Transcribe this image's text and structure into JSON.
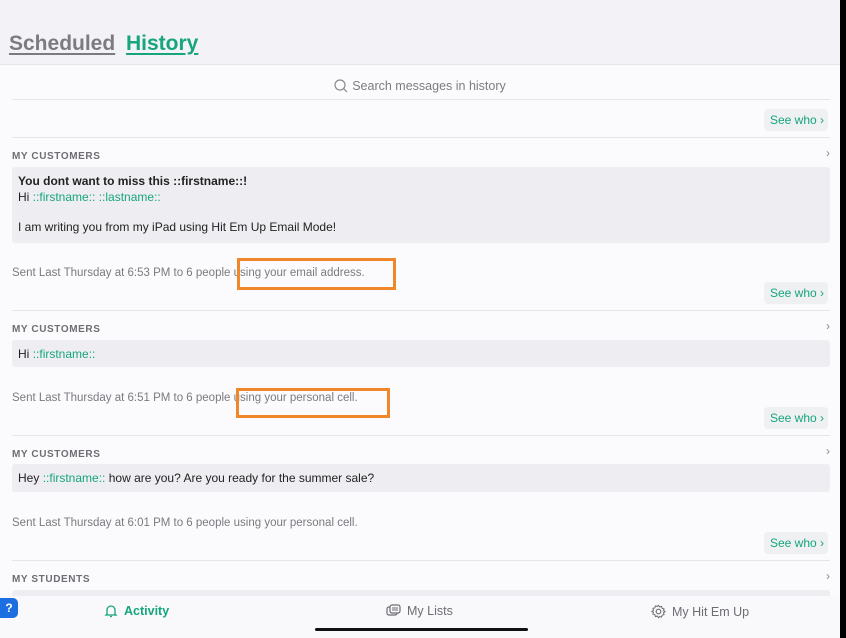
{
  "tabs": {
    "scheduled": "Scheduled",
    "history": "History"
  },
  "search": {
    "placeholder": "Search messages in history"
  },
  "see_who": "See who ›",
  "messages": [
    {
      "group": "MY CUSTOMERS",
      "subject": "You dont want to miss this ::firstname::!",
      "greeting": "Hi",
      "vars": "::firstname:: ::lastname::",
      "body": "I am writing you from my iPad using Hit Em Up Email Mode!",
      "sent": "Sent Last Thursday at 6:53 PM to 6 people",
      "via": " using your email address."
    },
    {
      "group": "MY CUSTOMERS",
      "greeting": "Hi",
      "vars": "::firstname::",
      "sent": "Sent Last Thursday at 6:51 PM to 6 people",
      "via": " using your personal cell."
    },
    {
      "group": "MY CUSTOMERS",
      "greeting": "Hey",
      "vars": "::firstname::",
      "body": "how are you? Are you ready for the summer sale?",
      "sent": "Sent Last Thursday at 6:01 PM to 6 people",
      "via": " using your personal cell."
    },
    {
      "group": "MY STUDENTS"
    }
  ],
  "tabbar": {
    "activity": "Activity",
    "lists": "My Lists",
    "account": "My Hit Em Up"
  },
  "colors": {
    "accent": "#16a57d",
    "highlight": "#f0872a"
  }
}
